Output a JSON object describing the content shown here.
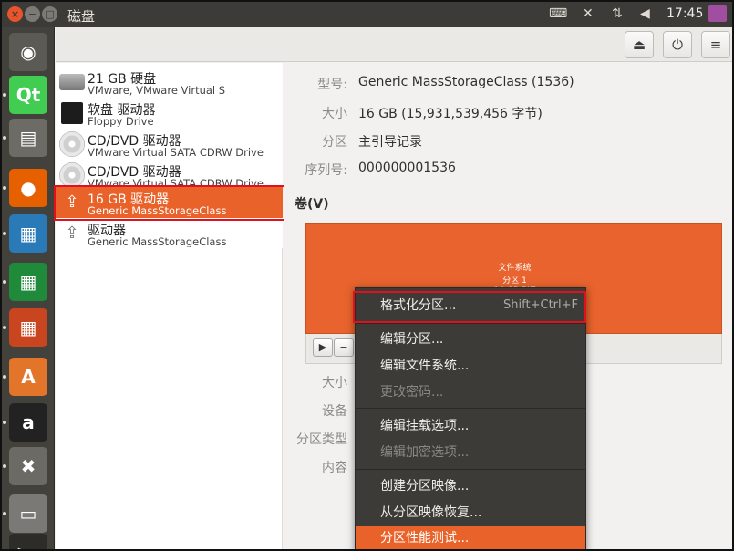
{
  "window": {
    "title": "磁盘"
  },
  "topbar": {
    "time": "17:45",
    "keyboard_icon": "⌨",
    "sort_icon": "⇅",
    "wifi_icon": "✕",
    "volume_icon": "◀"
  },
  "launcher": {
    "apps": [
      {
        "name": "ubuntu-dash",
        "glyph": "◉",
        "bg": "#5b5a55"
      },
      {
        "name": "qt-creator",
        "glyph": "Qt",
        "bg": "#41cd52"
      },
      {
        "name": "files",
        "glyph": "▤",
        "bg": "#6d6b66"
      },
      {
        "name": "firefox",
        "glyph": "●",
        "bg": "#e66000"
      },
      {
        "name": "writer",
        "glyph": "▦",
        "bg": "#2a7ab8"
      },
      {
        "name": "calc",
        "glyph": "▦",
        "bg": "#1f8a3a"
      },
      {
        "name": "impress",
        "glyph": "▦",
        "bg": "#c9451f"
      },
      {
        "name": "software-center",
        "glyph": "A",
        "bg": "#e3752b"
      },
      {
        "name": "amazon",
        "glyph": "a",
        "bg": "#222"
      },
      {
        "name": "settings",
        "glyph": "✖",
        "bg": "#6b6a65"
      },
      {
        "name": "disks",
        "glyph": "▭",
        "bg": "#7a7975"
      },
      {
        "name": "terminal",
        "glyph": ">_",
        "bg": "#2d2c28"
      }
    ]
  },
  "header": {
    "eject_icon": "⏏",
    "power_icon": "⏻",
    "menu_icon": "≡"
  },
  "devices": [
    {
      "name": "21 GB 硬盘",
      "sub": "VMware, VMware Virtual S",
      "icon": "hdd"
    },
    {
      "name": "软盘 驱动器",
      "sub": "Floppy Drive",
      "icon": "floppy"
    },
    {
      "name": "CD/DVD 驱动器",
      "sub": "VMware Virtual SATA CDRW Drive",
      "icon": "cd"
    },
    {
      "name": "CD/DVD 驱动器",
      "sub": "VMware Virtual SATA CDRW Drive",
      "icon": "cd"
    },
    {
      "name": "16 GB 驱动器",
      "sub": "Generic MassStorageClass",
      "icon": "usb",
      "selected": true
    },
    {
      "name": "驱动器",
      "sub": "Generic MassStorageClass",
      "icon": "usb"
    }
  ],
  "details": {
    "model_label": "型号:",
    "model_value": "Generic MassStorageClass (1536)",
    "size_label": "大小",
    "size_value": "16 GB (15,931,539,456 字节)",
    "partition_label": "分区",
    "partition_value": "主引导记录",
    "serial_label": "序列号:",
    "serial_value": "000000001536",
    "volumes_title": "卷(V)",
    "volume": {
      "line1": "文件系统",
      "line2": "分区 1",
      "line3": "16 GB FAT"
    },
    "lower_labels": [
      "大小",
      "设备",
      "分区类型",
      "内容"
    ]
  },
  "menu": {
    "items": [
      {
        "label": "格式化分区...",
        "accel": "Shift+Ctrl+F",
        "disabled": false
      },
      {
        "label": "编辑分区...",
        "disabled": false
      },
      {
        "label": "编辑文件系统...",
        "disabled": false
      },
      {
        "label": "更改密码...",
        "disabled": true
      },
      {
        "label": "编辑挂载选项...",
        "disabled": false
      },
      {
        "label": "编辑加密选项...",
        "disabled": true
      },
      {
        "label": "创建分区映像...",
        "disabled": false
      },
      {
        "label": "从分区映像恢复...",
        "disabled": false
      },
      {
        "label": "分区性能测试...",
        "disabled": false,
        "active": true
      }
    ]
  }
}
